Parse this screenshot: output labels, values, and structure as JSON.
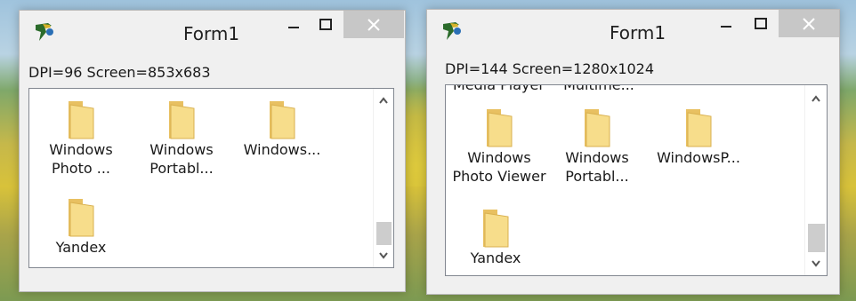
{
  "window_left": {
    "title": "Form1",
    "info": "DPI=96 Screen=853x683",
    "items": [
      {
        "line1": "Windows",
        "line2": "Photo ..."
      },
      {
        "line1": "Windows",
        "line2": "Portabl..."
      },
      {
        "line1": "Windows...",
        "line2": ""
      },
      {
        "line1": "Yandex",
        "line2": ""
      }
    ]
  },
  "window_right": {
    "title": "Form1",
    "info": "DPI=144 Screen=1280x1024",
    "partial_top": [
      "Media Player",
      "Multime..."
    ],
    "items": [
      {
        "line1": "Windows",
        "line2": "Photo Viewer"
      },
      {
        "line1": "Windows",
        "line2": "Portabl..."
      },
      {
        "line1": "WindowsP...",
        "line2": ""
      },
      {
        "line1": "Yandex",
        "line2": ""
      }
    ]
  },
  "icons": {
    "app": "delphi-helmet-icon",
    "minimize": "minimize-icon",
    "maximize": "maximize-icon",
    "close": "close-icon",
    "folder": "folder-icon",
    "scroll_up": "chevron-up-icon",
    "scroll_down": "chevron-down-icon"
  },
  "colors": {
    "window_bg": "#f0f0f0",
    "close_button": "#c7c7c7",
    "list_bg": "#ffffff",
    "folder": "#f3d27a"
  }
}
